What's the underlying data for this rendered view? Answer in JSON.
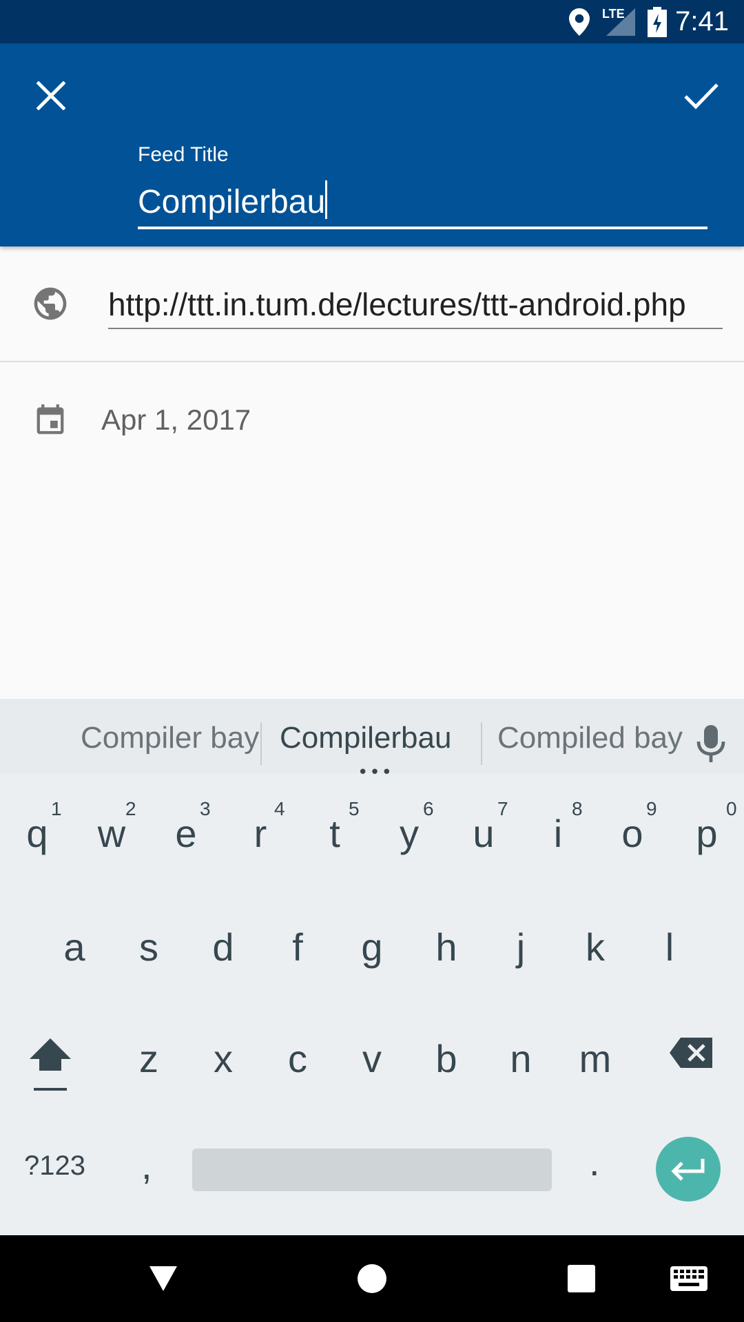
{
  "status_bar": {
    "time": "7:41",
    "network": "LTE"
  },
  "app_bar": {
    "close_icon": "close-icon",
    "confirm_icon": "check-icon",
    "title_label": "Feed Title",
    "title_value": "Compilerbau"
  },
  "form": {
    "url_value": "http://ttt.in.tum.de/lectures/ttt-android.php",
    "date_value": "Apr 1, 2017"
  },
  "keyboard": {
    "suggestions": [
      "Compiler bay",
      "Compilerbau",
      "Compiled bay"
    ],
    "row1": [
      "q",
      "w",
      "e",
      "r",
      "t",
      "y",
      "u",
      "i",
      "o",
      "p"
    ],
    "row1_hints": [
      "1",
      "2",
      "3",
      "4",
      "5",
      "6",
      "7",
      "8",
      "9",
      "0"
    ],
    "row2": [
      "a",
      "s",
      "d",
      "f",
      "g",
      "h",
      "j",
      "k",
      "l"
    ],
    "row3": [
      "z",
      "x",
      "c",
      "v",
      "b",
      "n",
      "m"
    ],
    "symbols_label": "?123",
    "comma": ",",
    "period": "."
  },
  "colors": {
    "status_bar": "#013464",
    "app_bar": "#015296",
    "enter_key": "#4db6ac"
  }
}
